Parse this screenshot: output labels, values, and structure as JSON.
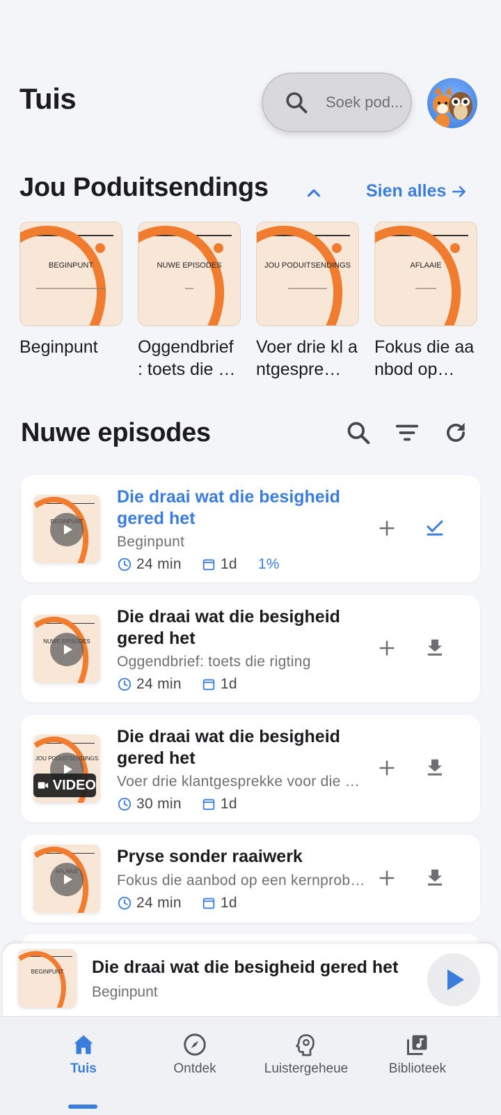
{
  "header": {
    "title": "Tuis",
    "search_placeholder": "Soek pod..."
  },
  "podcasts": {
    "title": "Jou Poduitsendings",
    "see_all": "Sien alles",
    "items": [
      {
        "art_label": "BEGINPUNT",
        "name": "Beginpunt"
      },
      {
        "art_label": "NUWE EPISODES",
        "name": "Oggendbrief : toets die …"
      },
      {
        "art_label": "JOU PODUITSENDINGS",
        "name": "Voer drie kl antgespre…"
      },
      {
        "art_label": "AFLAAIE",
        "name": "Fokus die aanbod op…"
      }
    ]
  },
  "episodes": {
    "title": "Nuwe episodes",
    "items": [
      {
        "thumb_label": "BEGINPUNT",
        "title": "Die draai wat die besigheid gered het",
        "podcast": "Beginpunt",
        "duration": "24 min",
        "date": "1d",
        "progress": "1%",
        "state": "played",
        "video": false
      },
      {
        "thumb_label": "NUWE EPISODES",
        "title": "Die draai wat die besigheid gered het",
        "podcast": "Oggendbrief: toets die rigting",
        "duration": "24 min",
        "date": "1d",
        "state": "download",
        "video": false
      },
      {
        "thumb_label": "JOU PODUITSENDINGS",
        "title": "Die draai wat die besigheid gered het",
        "podcast": "Voer drie klantgesprekke voor die bou",
        "duration": "30 min",
        "date": "1d",
        "state": "download",
        "video": true,
        "video_label": "VIDEO"
      },
      {
        "thumb_label": "AFLAAIE",
        "title": "Pryse sonder raaiwerk",
        "podcast": "Fokus die aanbod op een kernprobleem",
        "duration": "24 min",
        "date": "1d",
        "state": "download",
        "video": false
      }
    ]
  },
  "mini_player": {
    "thumb_label": "BEGINPUNT",
    "title": "Die draai wat die besigheid gered het",
    "podcast": "Beginpunt"
  },
  "nav": {
    "items": [
      {
        "label": "Tuis",
        "icon": "home-icon",
        "active": true
      },
      {
        "label": "Ontdek",
        "icon": "compass-icon",
        "active": false
      },
      {
        "label": "Luistergeheue",
        "icon": "brain-icon",
        "active": false
      },
      {
        "label": "Biblioteek",
        "icon": "library-music-icon",
        "active": false
      }
    ]
  },
  "colors": {
    "accent": "#3b7ddd",
    "art_orange": "#f07c2f",
    "art_bg": "#f8e6d6",
    "background": "#f4f5f9"
  }
}
